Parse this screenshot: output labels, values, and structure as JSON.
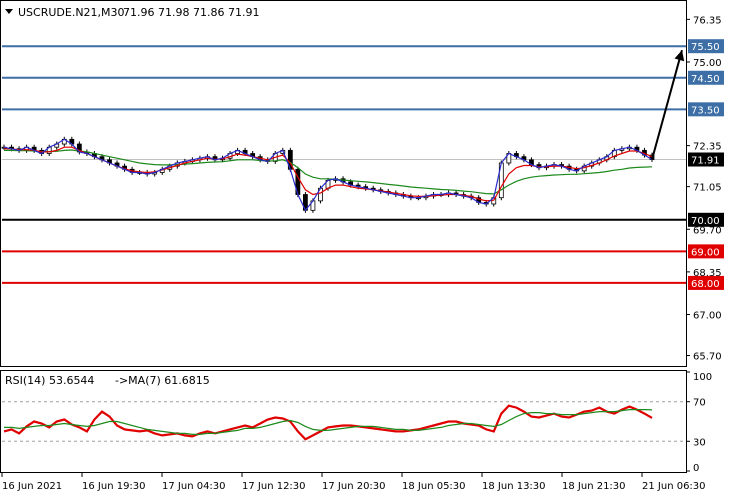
{
  "chart_data": {
    "type": "line",
    "title": "USCRUDE.N21,M30",
    "ohlc": "71.96 71.98 71.86 71.91",
    "current_price": "71.91",
    "price_ticks": [
      "76.35",
      "75.00",
      "72.35",
      "71.05",
      "69.70",
      "68.35",
      "67.00",
      "65.70"
    ],
    "price_range": [
      65.4,
      76.9
    ],
    "time_labels": [
      "16 Jun 2021",
      "16 Jun 19:30",
      "17 Jun 04:30",
      "17 Jun 12:30",
      "17 Jun 20:30",
      "18 Jun 05:30",
      "18 Jun 13:30",
      "18 Jun 21:30",
      "21 Jun 06:30"
    ],
    "levels": [
      {
        "value": 75.5,
        "label": "75.50",
        "color": "#3d6fa6"
      },
      {
        "value": 74.5,
        "label": "74.50",
        "color": "#3d6fa6"
      },
      {
        "value": 73.5,
        "label": "73.50",
        "color": "#3d6fa6"
      },
      {
        "value": 70.0,
        "label": "70.00",
        "color": "#000000"
      },
      {
        "value": 69.0,
        "label": "69.00",
        "color": "#e00000"
      },
      {
        "value": 68.0,
        "label": "68.00",
        "color": "#e00000"
      }
    ],
    "close_series": [
      72.3,
      72.25,
      72.2,
      72.3,
      72.2,
      72.1,
      72.3,
      72.4,
      72.55,
      72.4,
      72.15,
      72.1,
      72.0,
      71.9,
      71.8,
      71.7,
      71.6,
      71.5,
      71.5,
      71.45,
      71.5,
      71.6,
      71.7,
      71.8,
      71.85,
      71.9,
      71.95,
      72.0,
      71.9,
      71.95,
      72.1,
      72.2,
      72.1,
      72.0,
      71.9,
      71.85,
      72.1,
      72.2,
      71.6,
      70.8,
      70.3,
      70.6,
      71.0,
      71.25,
      71.3,
      71.2,
      71.1,
      71.05,
      71.0,
      70.95,
      70.9,
      70.85,
      70.8,
      70.75,
      70.7,
      70.7,
      70.75,
      70.8,
      70.8,
      70.85,
      70.8,
      70.75,
      70.7,
      70.55,
      70.5,
      70.7,
      71.8,
      72.1,
      72.0,
      71.9,
      71.75,
      71.65,
      71.7,
      71.75,
      71.7,
      71.6,
      71.55,
      71.7,
      71.8,
      71.9,
      72.0,
      72.2,
      72.25,
      72.3,
      72.2,
      72.05,
      71.91
    ],
    "ma_fast": [
      72.25,
      72.25,
      72.22,
      72.22,
      72.2,
      72.15,
      72.15,
      72.2,
      72.3,
      72.3,
      72.2,
      72.1,
      72.0,
      71.9,
      71.8,
      71.7,
      71.62,
      71.55,
      71.52,
      71.5,
      71.52,
      71.58,
      71.65,
      71.72,
      71.8,
      71.85,
      71.9,
      71.95,
      71.92,
      71.93,
      72.0,
      72.08,
      72.05,
      72.0,
      71.95,
      71.9,
      71.98,
      72.05,
      71.8,
      71.35,
      70.95,
      70.8,
      70.85,
      71.0,
      71.1,
      71.1,
      71.05,
      71.0,
      70.98,
      70.95,
      70.92,
      70.88,
      70.84,
      70.8,
      70.76,
      70.74,
      70.74,
      70.76,
      70.78,
      70.8,
      70.8,
      70.78,
      70.74,
      70.66,
      70.6,
      70.62,
      71.05,
      71.45,
      71.65,
      71.72,
      71.72,
      71.68,
      71.68,
      71.7,
      71.7,
      71.66,
      71.62,
      71.65,
      71.72,
      71.8,
      71.9,
      72.02,
      72.1,
      72.18,
      72.18,
      72.1,
      72.0
    ],
    "ma_slow": [
      72.2,
      72.2,
      72.19,
      72.19,
      72.18,
      72.16,
      72.16,
      72.17,
      72.2,
      72.21,
      72.18,
      72.15,
      72.1,
      72.05,
      72.0,
      71.95,
      71.9,
      71.85,
      71.8,
      71.77,
      71.75,
      71.74,
      71.74,
      71.75,
      71.76,
      71.78,
      71.8,
      71.82,
      71.83,
      71.84,
      71.87,
      71.9,
      71.9,
      71.9,
      71.88,
      71.86,
      71.87,
      71.9,
      71.82,
      71.65,
      71.45,
      71.35,
      71.3,
      71.3,
      71.28,
      71.26,
      71.24,
      71.22,
      71.2,
      71.18,
      71.15,
      71.12,
      71.1,
      71.07,
      71.04,
      71.02,
      71.0,
      70.98,
      70.96,
      70.95,
      70.93,
      70.91,
      70.89,
      70.86,
      70.83,
      70.82,
      70.95,
      71.1,
      71.22,
      71.3,
      71.35,
      71.38,
      71.4,
      71.42,
      71.43,
      71.44,
      71.44,
      71.46,
      71.48,
      71.5,
      71.53,
      71.57,
      71.6,
      71.64,
      71.66,
      71.67,
      71.68
    ],
    "rsi": {
      "label": "RSI(14) 53.6544",
      "ma_label": "->MA(7) 61.6815",
      "ticks": [
        "100",
        "70",
        "30",
        "0"
      ],
      "levels": [
        70,
        30
      ],
      "values": [
        40,
        42,
        38,
        45,
        50,
        48,
        44,
        50,
        52,
        47,
        44,
        40,
        52,
        60,
        55,
        46,
        42,
        41,
        40,
        41,
        38,
        36,
        37,
        38,
        36,
        35,
        38,
        40,
        38,
        40,
        42,
        44,
        46,
        44,
        48,
        52,
        54,
        53,
        50,
        40,
        32,
        36,
        40,
        44,
        45,
        46,
        46,
        45,
        44,
        43,
        42,
        41,
        40,
        40,
        41,
        42,
        44,
        46,
        48,
        50,
        50,
        48,
        47,
        46,
        42,
        40,
        58,
        66,
        64,
        60,
        55,
        54,
        56,
        58,
        55,
        54,
        57,
        60,
        61,
        64,
        60,
        58,
        62,
        65,
        62,
        58,
        53.65
      ],
      "ma_values": [
        44,
        44,
        43,
        44,
        45,
        46,
        46,
        47,
        48,
        47,
        46,
        45,
        46,
        48,
        50,
        50,
        48,
        46,
        44,
        42,
        41,
        40,
        39,
        38,
        38,
        37,
        37,
        38,
        38,
        39,
        40,
        41,
        43,
        43,
        44,
        46,
        48,
        50,
        51,
        49,
        45,
        42,
        41,
        41,
        42,
        43,
        44,
        45,
        45,
        45,
        44,
        43,
        42,
        42,
        41,
        41,
        42,
        43,
        44,
        46,
        47,
        48,
        48,
        47,
        46,
        45,
        47,
        51,
        55,
        58,
        59,
        59,
        58,
        58,
        57,
        57,
        57,
        58,
        59,
        60,
        60,
        60,
        61,
        62,
        62,
        62,
        61.68
      ]
    }
  }
}
